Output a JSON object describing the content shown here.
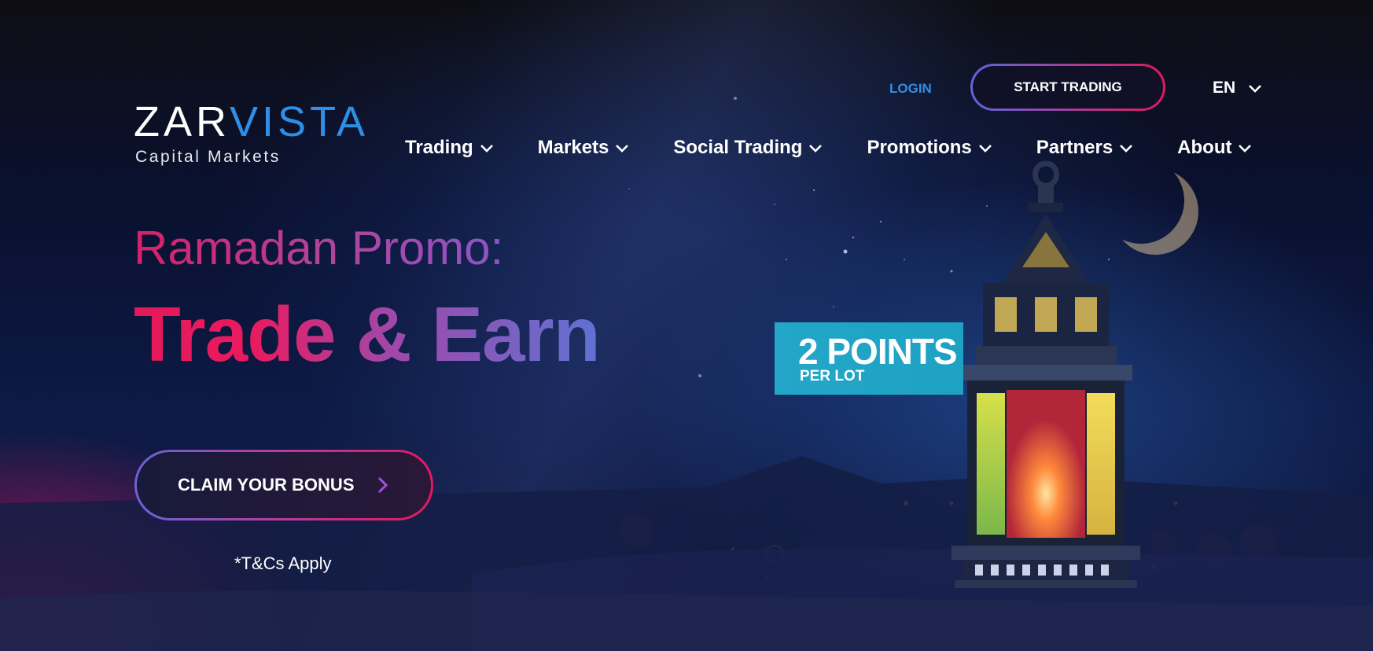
{
  "brand": {
    "logo_part1": "ZAR",
    "logo_part2": "VISTA",
    "tagline": "Capital Markets"
  },
  "topbar": {
    "login_label": "LOGIN",
    "start_trading_label": "START TRADING",
    "language": "EN"
  },
  "nav": {
    "items": [
      {
        "label": "Trading"
      },
      {
        "label": "Markets"
      },
      {
        "label": "Social Trading"
      },
      {
        "label": "Promotions"
      },
      {
        "label": "Partners"
      },
      {
        "label": "About"
      }
    ]
  },
  "hero": {
    "promo_heading": "Ramadan Promo:",
    "main_heading": "Trade & Earn",
    "badge_big": "2 POINTS",
    "badge_small": "PER LOT",
    "cta_label": "CLAIM YOUR BONUS",
    "terms": "*T&Cs Apply"
  },
  "colors": {
    "accent_blue": "#2f8fe6",
    "accent_pink": "#e2195b",
    "accent_purple": "#5e72d4",
    "badge_cyan": "#23a6c7"
  },
  "icons": {
    "dropdown": "chevron-down-icon",
    "cta_arrow": "chevron-right-icon"
  }
}
